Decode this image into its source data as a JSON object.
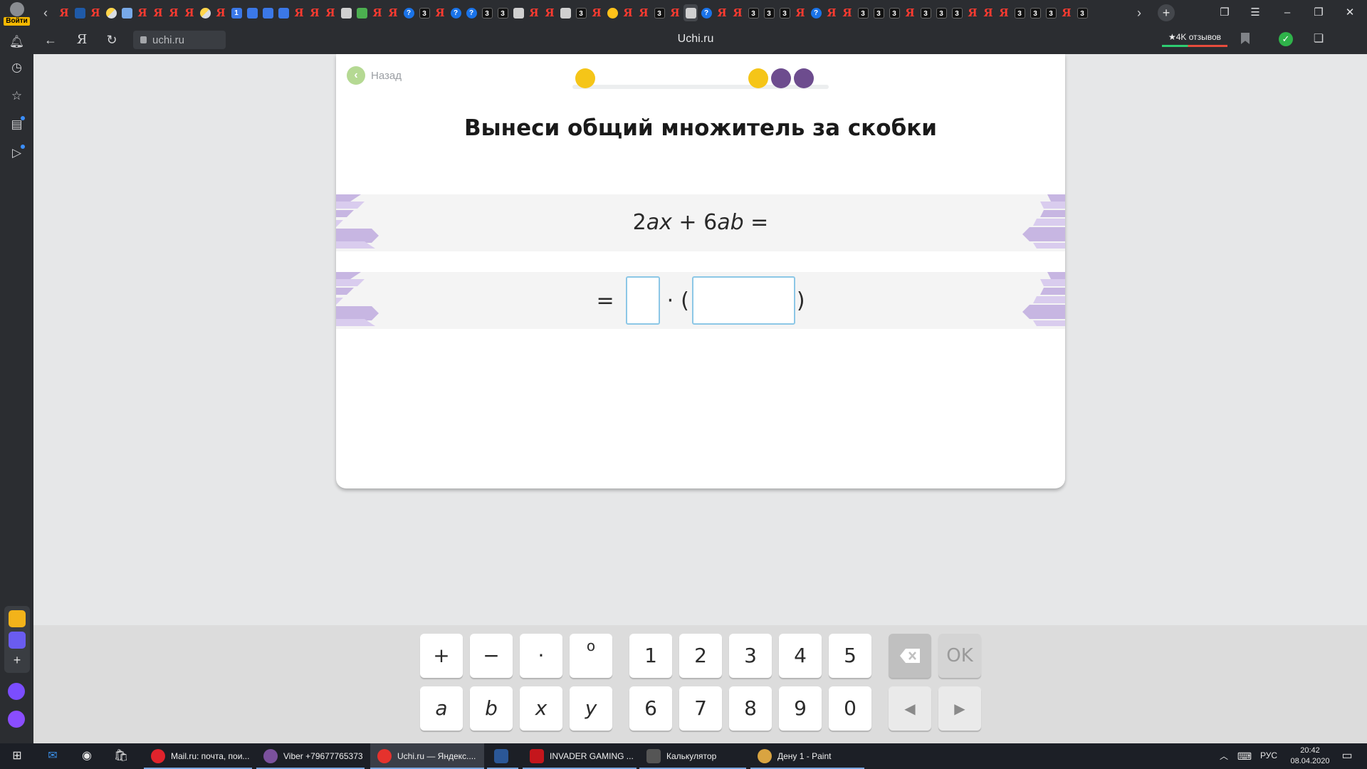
{
  "browser": {
    "login_label": "Войти",
    "page_title": "Uchi.ru",
    "url": "uchi.ru",
    "reviews_label": "★4K отзывов",
    "yandex_glyph": "Я",
    "tab_count_glyph": "3",
    "tab_one_glyph": "1",
    "tab_question_glyph": "?"
  },
  "lesson": {
    "back_label": "Назад",
    "title": "Вынеси общий множитель за скобки",
    "expression": {
      "coef1": "2",
      "var1": "ax",
      "plus": " + ",
      "coef2": "6",
      "var2": "ab",
      "equals": " ="
    },
    "answer": {
      "equals": "=",
      "dot": "·",
      "open_paren": "(",
      "close_paren": ")",
      "box1_value": "",
      "box2_value": ""
    },
    "progress": {
      "dots": [
        "yellow",
        "yellow",
        "purple",
        "purple"
      ]
    }
  },
  "keypad": {
    "row1": [
      "+",
      "−",
      "·",
      "o",
      "1",
      "2",
      "3",
      "4",
      "5"
    ],
    "row2": [
      "a",
      "b",
      "x",
      "y",
      "6",
      "7",
      "8",
      "9",
      "0"
    ],
    "backspace_icon": "backspace-icon",
    "ok_label": "OK",
    "left_label": "◀",
    "right_label": "▶"
  },
  "colors": {
    "progress_yellow": "#f5c518",
    "progress_purple": "#6d4c8e",
    "ribbon": "#c7b6e2",
    "answer_box_border": "#8cc7e6",
    "back_green": "#b5d993"
  },
  "taskbar": {
    "apps": [
      {
        "label": "Mail.ru: почта, пои...",
        "active": false
      },
      {
        "label": "Viber +79677765373",
        "active": false
      },
      {
        "label": "Uchi.ru — Яндекс....",
        "active": true
      },
      {
        "label": "",
        "active": false
      },
      {
        "label": "INVADER GAMING ...",
        "active": false
      },
      {
        "label": "Калькулятор",
        "active": false
      },
      {
        "label": "Дену 1 - Paint",
        "active": false
      }
    ],
    "lang": "РУС",
    "time": "20:42",
    "date": "08.04.2020"
  }
}
